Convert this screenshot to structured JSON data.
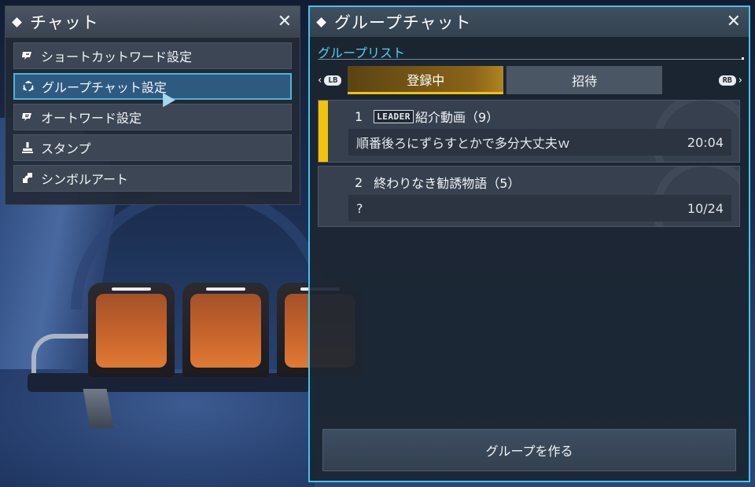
{
  "colors": {
    "accent": "#44c3e8",
    "active_tab": "#f2c20c",
    "panel_bg": "#222a37",
    "section_label": "#4fd0f0"
  },
  "chat_menu": {
    "title": "チャット",
    "close_icon": "close-icon",
    "items": [
      {
        "label": "ショートカットワード設定",
        "icon": "shortcut-word-icon"
      },
      {
        "label": "グループチャット設定",
        "icon": "group-chat-icon",
        "selected": true
      },
      {
        "label": "オートワード設定",
        "icon": "auto-word-icon"
      },
      {
        "label": "スタンプ",
        "icon": "stamp-icon"
      },
      {
        "label": "シンボルアート",
        "icon": "symbol-art-icon"
      }
    ]
  },
  "group_chat": {
    "title": "グループチャット",
    "section_label": "グループリスト",
    "nav_left": "LB",
    "nav_right": "RB",
    "tabs": [
      {
        "label": "登録中",
        "active": true
      },
      {
        "label": "招待",
        "active": false
      }
    ],
    "groups": [
      {
        "number": "1",
        "badge": "LEADER",
        "name": "紹介動画（9）",
        "last_message": "順番後ろにずらすとかで多分大丈夫ｗ",
        "time": "20:04",
        "active": true
      },
      {
        "number": "2",
        "name": "終わりなき勧誘物語（5）",
        "last_message": "?",
        "time": "10/24",
        "active": false
      }
    ],
    "create_button": "グループを作る"
  }
}
